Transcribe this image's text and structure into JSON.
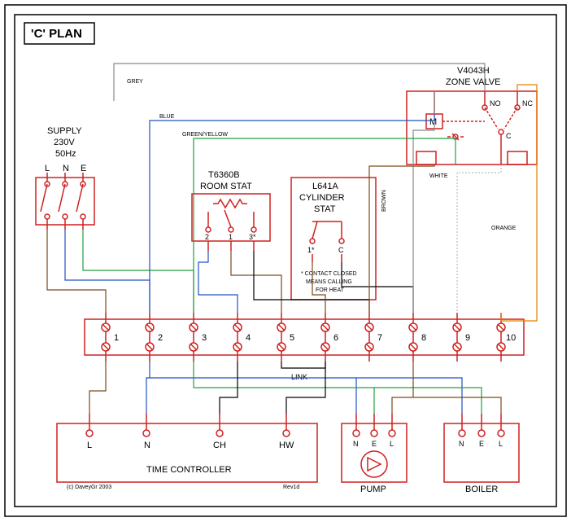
{
  "title": "'C' PLAN",
  "supply": {
    "label": "SUPPLY",
    "voltage": "230V",
    "freq": "50Hz",
    "terminals": [
      "L",
      "N",
      "E"
    ]
  },
  "zone_valve": {
    "model": "V4043H",
    "label": "ZONE VALVE",
    "m": "M",
    "no": "NO",
    "nc": "NC",
    "c": "C"
  },
  "room_stat": {
    "model": "T6360B",
    "label": "ROOM STAT",
    "terminals": [
      "2",
      "1",
      "3*"
    ],
    "note": "*"
  },
  "cyl_stat": {
    "model": "L641A",
    "label1": "CYLINDER",
    "label2": "STAT",
    "terminals": [
      "1*",
      "C"
    ],
    "note1": "* CONTACT CLOSED",
    "note2": "MEANS CALLING",
    "note3": "FOR HEAT"
  },
  "junction": {
    "terminals": [
      "1",
      "2",
      "3",
      "4",
      "5",
      "6",
      "7",
      "8",
      "9",
      "10"
    ],
    "link": "LINK"
  },
  "time_controller": {
    "label": "TIME CONTROLLER",
    "terminals": [
      "L",
      "N",
      "CH",
      "HW"
    ]
  },
  "pump": {
    "label": "PUMP",
    "terminals": [
      "N",
      "E",
      "L"
    ]
  },
  "boiler": {
    "label": "BOILER",
    "terminals": [
      "N",
      "E",
      "L"
    ]
  },
  "wire_labels": {
    "grey": "GREY",
    "blue": "BLUE",
    "green": "GREEN/YELLOW",
    "brown": "BROWN",
    "white": "WHITE",
    "orange": "ORANGE"
  },
  "footer": {
    "copyright": "(c) DaveyGr 2003",
    "rev": "Rev1d"
  }
}
